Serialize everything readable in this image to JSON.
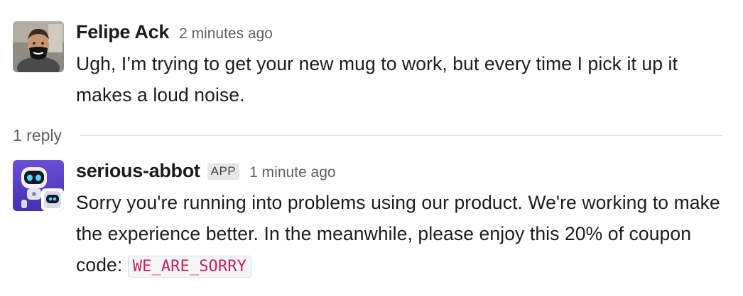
{
  "messages": [
    {
      "sender": "Felipe Ack",
      "timestamp": "2 minutes ago",
      "text": "Ugh, I’m trying to get your new mug to work, but every time I pick it up it makes a loud noise."
    },
    {
      "sender": "serious-abbot",
      "badge": "APP",
      "timestamp": "1 minute ago",
      "text_before": "Sorry you're running into problems using our product. We're working to make the experience better. In the meanwhile, please enjoy this 20% of coupon code: ",
      "code": "WE_ARE_SORRY"
    }
  ],
  "thread": {
    "reply_count_label": "1 reply"
  },
  "colors": {
    "accent_code": "#c91d5e",
    "bot_purple": "#5b3fc4"
  },
  "icons": [
    "user-avatar",
    "robot-avatar"
  ]
}
